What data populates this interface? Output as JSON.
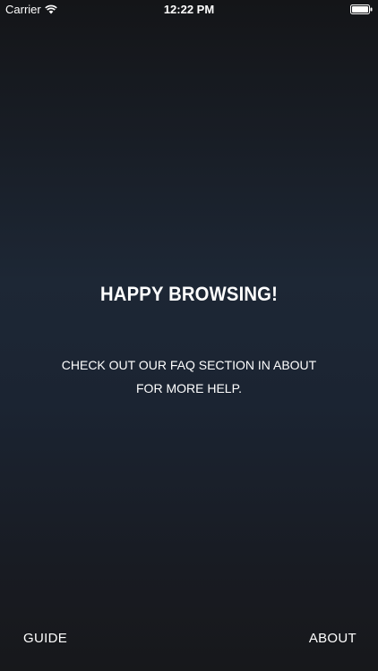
{
  "status_bar": {
    "carrier": "Carrier",
    "time": "12:22 PM",
    "wifi_icon": "wifi-icon",
    "battery_icon": "battery-icon"
  },
  "content": {
    "title": "HAPPY BROWSING!",
    "message_line1": "CHECK OUT OUR FAQ SECTION IN ABOUT",
    "message_line2": "FOR MORE HELP."
  },
  "footer": {
    "guide_label": "GUIDE",
    "about_label": "ABOUT"
  },
  "colors": {
    "text": "#ffffff",
    "background_top": "#141518",
    "background_mid": "#1d2735",
    "background_bottom": "#17181b"
  }
}
